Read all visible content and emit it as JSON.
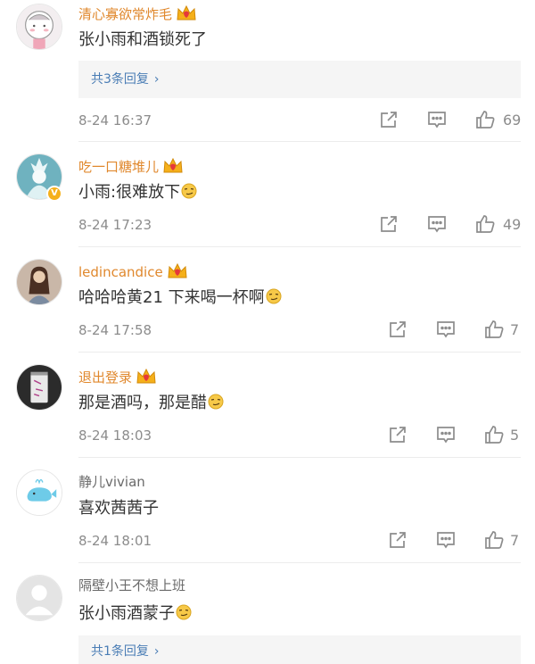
{
  "comments": [
    {
      "name": "清心寡欲常炸毛",
      "text": "张小雨和酒锁死了",
      "replies": "共3条回复",
      "time": "8-24 16:37",
      "likes": "69"
    },
    {
      "name": "吃一口糖堆儿",
      "text": "小雨:很难放下",
      "time": "8-24 17:23",
      "likes": "49"
    },
    {
      "name": "ledincandice",
      "text": "哈哈哈黄21 下来喝一杯啊",
      "time": "8-24 17:58",
      "likes": "7"
    },
    {
      "name": "退出登录",
      "text": "那是酒吗，那是醋",
      "time": "8-24 18:03",
      "likes": "5"
    },
    {
      "name": "静儿vivian",
      "text": "喜欢茜茜子",
      "time": "8-24 18:01",
      "likes": "7"
    },
    {
      "name": "隔壁小王不想上班",
      "text": "张小雨酒蒙子",
      "replies": "共1条回复"
    }
  ],
  "icons": {
    "repost": "share-icon",
    "comment": "comment-icon",
    "like": "thumbs-up-icon",
    "crown": "vip-crown-icon",
    "emoji": "smirk-emoji-icon"
  },
  "colors": {
    "vip_name": "#e0882d",
    "normal_name": "#6a6a6a",
    "link": "#4a7db5",
    "meta": "#8c8c8c"
  }
}
